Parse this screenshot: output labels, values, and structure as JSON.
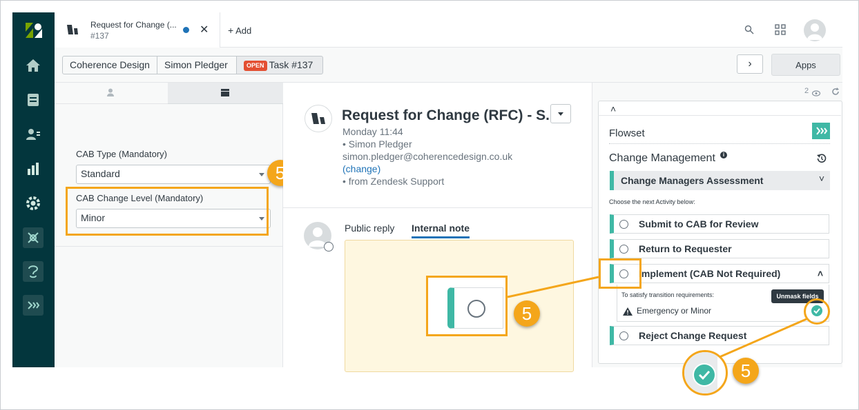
{
  "tab": {
    "title": "Request for Change (...",
    "subtitle": "#137",
    "add_label": "Add"
  },
  "breadcrumbs": [
    "Coherence Design",
    "Simon Pledger"
  ],
  "status_badge": "OPEN",
  "task_label": "Task #137",
  "apps_label": "Apps",
  "left_form": {
    "field1_label": "CAB Type (Mandatory)",
    "field1_value": "Standard",
    "field2_label": "CAB Change Level (Mandatory)",
    "field2_value": "Minor"
  },
  "ticket": {
    "title": "Request for Change (RFC) - S...",
    "time": "Monday 11:44",
    "author": "• Simon Pledger",
    "email": "simon.pledger@coherencedesign.co.uk",
    "change_link": "(change)",
    "source": "• from Zendesk Support"
  },
  "reply_tabs": {
    "public": "Public reply",
    "internal": "Internal note"
  },
  "right_panel": {
    "views_count": "2",
    "flowset_label": "Flowset",
    "section_title": "Change Management",
    "current_stage": "Change Managers Assessment",
    "instructions": "Choose the next Activity below:",
    "activities": [
      "Submit to CAB for Review",
      "Return to Requester",
      "Implement (CAB Not Required)",
      "Reject Change Request"
    ],
    "requirements_note": "To satisfy transition requirements:",
    "requirement_item": "Emergency or Minor",
    "tooltip": "Unmask fields"
  },
  "callouts": {
    "step": "5"
  },
  "colors": {
    "nav_bg": "#03363d",
    "accent": "#3fb8a5",
    "highlight": "#f4a61b",
    "note_bg": "#fef7e0",
    "open_badge": "#e34f32"
  }
}
